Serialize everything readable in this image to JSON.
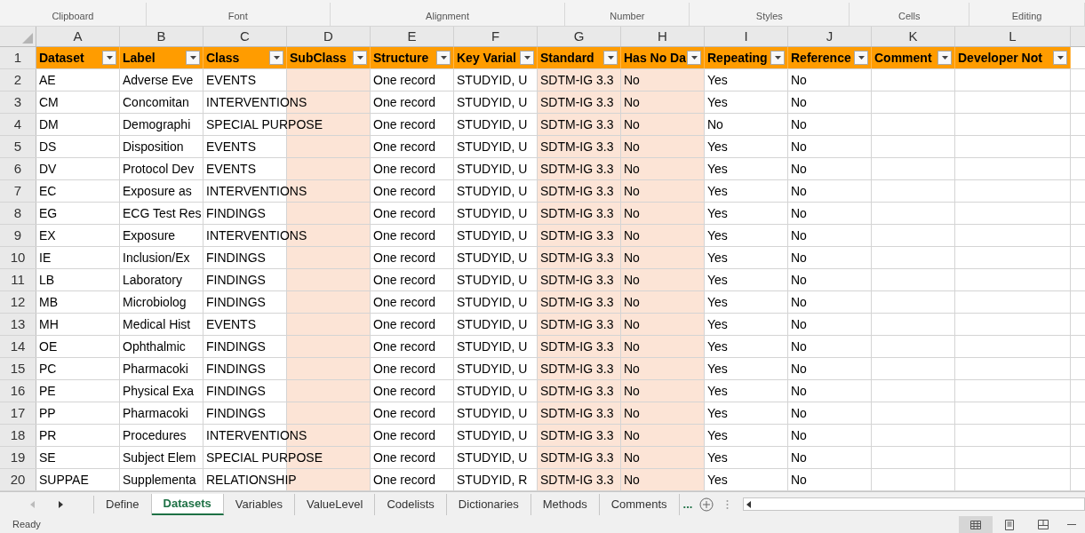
{
  "ribbon_groups": [
    "Clipboard",
    "Font",
    "Alignment",
    "Number",
    "Styles",
    "Cells",
    "Editing"
  ],
  "columns": [
    {
      "letter": "A",
      "shaded": false
    },
    {
      "letter": "B",
      "shaded": false
    },
    {
      "letter": "C",
      "shaded": false
    },
    {
      "letter": "D",
      "shaded": true
    },
    {
      "letter": "E",
      "shaded": false
    },
    {
      "letter": "F",
      "shaded": false
    },
    {
      "letter": "G",
      "shaded": true
    },
    {
      "letter": "H",
      "shaded": true
    },
    {
      "letter": "I",
      "shaded": false
    },
    {
      "letter": "J",
      "shaded": false
    },
    {
      "letter": "K",
      "shaded": false
    },
    {
      "letter": "L",
      "shaded": false
    }
  ],
  "header_row": {
    "number": "1",
    "cells": [
      "Dataset",
      "Label",
      "Class",
      "SubClass",
      "Structure",
      "Key Varial",
      "Standard",
      "Has No Da",
      "Repeating",
      "Reference",
      "Comment",
      "Developer Not"
    ]
  },
  "rows": [
    {
      "number": "2",
      "cells": [
        "AE",
        "Adverse Eve",
        "EVENTS",
        "",
        "One record",
        "STUDYID, U",
        "SDTM-IG 3.3",
        "No",
        "Yes",
        "No",
        "",
        ""
      ]
    },
    {
      "number": "3",
      "cells": [
        "CM",
        "Concomitan",
        "INTERVENTIONS",
        "",
        "One record",
        "STUDYID, U",
        "SDTM-IG 3.3",
        "No",
        "Yes",
        "No",
        "",
        ""
      ]
    },
    {
      "number": "4",
      "cells": [
        "DM",
        "Demographi",
        "SPECIAL PURPOSE",
        "",
        "One record",
        "STUDYID, U",
        "SDTM-IG 3.3",
        "No",
        "No",
        "No",
        "",
        ""
      ]
    },
    {
      "number": "5",
      "cells": [
        "DS",
        "Disposition",
        "EVENTS",
        "",
        "One record",
        "STUDYID, U",
        "SDTM-IG 3.3",
        "No",
        "Yes",
        "No",
        "",
        ""
      ]
    },
    {
      "number": "6",
      "cells": [
        "DV",
        "Protocol Dev",
        "EVENTS",
        "",
        "One record",
        "STUDYID, U",
        "SDTM-IG 3.3",
        "No",
        "Yes",
        "No",
        "",
        ""
      ]
    },
    {
      "number": "7",
      "cells": [
        "EC",
        "Exposure as",
        "INTERVENTIONS",
        "",
        "One record",
        "STUDYID, U",
        "SDTM-IG 3.3",
        "No",
        "Yes",
        "No",
        "",
        ""
      ]
    },
    {
      "number": "8",
      "cells": [
        "EG",
        "ECG Test Res",
        "FINDINGS",
        "",
        "One record",
        "STUDYID, U",
        "SDTM-IG 3.3",
        "No",
        "Yes",
        "No",
        "",
        ""
      ]
    },
    {
      "number": "9",
      "cells": [
        "EX",
        "Exposure",
        "INTERVENTIONS",
        "",
        "One record",
        "STUDYID, U",
        "SDTM-IG 3.3",
        "No",
        "Yes",
        "No",
        "",
        ""
      ]
    },
    {
      "number": "10",
      "cells": [
        "IE",
        "Inclusion/Ex",
        "FINDINGS",
        "",
        "One record",
        "STUDYID, U",
        "SDTM-IG 3.3",
        "No",
        "Yes",
        "No",
        "",
        ""
      ]
    },
    {
      "number": "11",
      "cells": [
        "LB",
        "Laboratory",
        "FINDINGS",
        "",
        "One record",
        "STUDYID, U",
        "SDTM-IG 3.3",
        "No",
        "Yes",
        "No",
        "",
        ""
      ]
    },
    {
      "number": "12",
      "cells": [
        "MB",
        "Microbiolog",
        "FINDINGS",
        "",
        "One record",
        "STUDYID, U",
        "SDTM-IG 3.3",
        "No",
        "Yes",
        "No",
        "",
        ""
      ]
    },
    {
      "number": "13",
      "cells": [
        "MH",
        "Medical Hist",
        "EVENTS",
        "",
        "One record",
        "STUDYID, U",
        "SDTM-IG 3.3",
        "No",
        "Yes",
        "No",
        "",
        ""
      ]
    },
    {
      "number": "14",
      "cells": [
        "OE",
        "Ophthalmic",
        "FINDINGS",
        "",
        "One record",
        "STUDYID, U",
        "SDTM-IG 3.3",
        "No",
        "Yes",
        "No",
        "",
        ""
      ]
    },
    {
      "number": "15",
      "cells": [
        "PC",
        "Pharmacoki",
        "FINDINGS",
        "",
        "One record",
        "STUDYID, U",
        "SDTM-IG 3.3",
        "No",
        "Yes",
        "No",
        "",
        ""
      ]
    },
    {
      "number": "16",
      "cells": [
        "PE",
        "Physical Exa",
        "FINDINGS",
        "",
        "One record",
        "STUDYID, U",
        "SDTM-IG 3.3",
        "No",
        "Yes",
        "No",
        "",
        ""
      ]
    },
    {
      "number": "17",
      "cells": [
        "PP",
        "Pharmacoki",
        "FINDINGS",
        "",
        "One record",
        "STUDYID, U",
        "SDTM-IG 3.3",
        "No",
        "Yes",
        "No",
        "",
        ""
      ]
    },
    {
      "number": "18",
      "cells": [
        "PR",
        "Procedures",
        "INTERVENTIONS",
        "",
        "One record",
        "STUDYID, U",
        "SDTM-IG 3.3",
        "No",
        "Yes",
        "No",
        "",
        ""
      ]
    },
    {
      "number": "19",
      "cells": [
        "SE",
        "Subject Elem",
        "SPECIAL PURPOSE",
        "",
        "One record",
        "STUDYID, U",
        "SDTM-IG 3.3",
        "No",
        "Yes",
        "No",
        "",
        ""
      ]
    },
    {
      "number": "20",
      "cells": [
        "SUPPAE",
        "Supplementa",
        "RELATIONSHIP",
        "",
        "One record",
        "STUDYID, R",
        "SDTM-IG 3.3",
        "No",
        "Yes",
        "No",
        "",
        ""
      ]
    }
  ],
  "sheet_tabs": [
    {
      "label": "Define",
      "selected": false
    },
    {
      "label": "Datasets",
      "selected": true
    },
    {
      "label": "Variables",
      "selected": false
    },
    {
      "label": "ValueLevel",
      "selected": false
    },
    {
      "label": "Codelists",
      "selected": false
    },
    {
      "label": "Dictionaries",
      "selected": false
    },
    {
      "label": "Methods",
      "selected": false
    },
    {
      "label": "Comments",
      "selected": false
    }
  ],
  "more_tabs": "...",
  "status_bar": {
    "text": "Ready"
  }
}
